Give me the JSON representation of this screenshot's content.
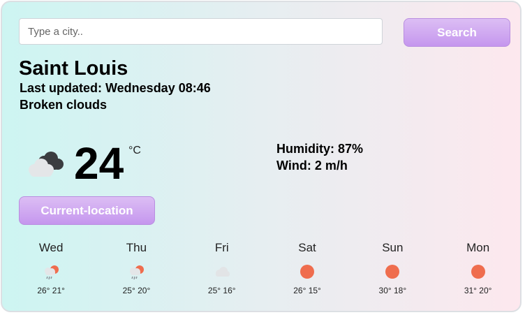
{
  "search": {
    "placeholder": "Type a city..",
    "button_label": "Search"
  },
  "current": {
    "city": "Saint Louis",
    "last_updated": "Last updated: Wednesday 08:46",
    "description": "Broken clouds",
    "temperature": "24",
    "unit": "°C",
    "humidity": "Humidity: 87%",
    "wind": "Wind: 2 m/h",
    "icon": "broken-clouds-icon"
  },
  "location_button_label": "Current-location",
  "forecast": [
    {
      "day": "Wed",
      "temps": "26° 21°",
      "icon": "rain-sun-icon"
    },
    {
      "day": "Thu",
      "temps": "25° 20°",
      "icon": "rain-sun-icon"
    },
    {
      "day": "Fri",
      "temps": "25° 16°",
      "icon": "cloud-icon"
    },
    {
      "day": "Sat",
      "temps": "26° 15°",
      "icon": "sun-icon"
    },
    {
      "day": "Sun",
      "temps": "30° 18°",
      "icon": "sun-icon"
    },
    {
      "day": "Mon",
      "temps": "31° 20°",
      "icon": "sun-icon"
    }
  ],
  "colors": {
    "gradient_left": "#cdf5f2",
    "gradient_right": "#fde8ee",
    "button": "#c596ee",
    "sun": "#ef6d4e"
  }
}
